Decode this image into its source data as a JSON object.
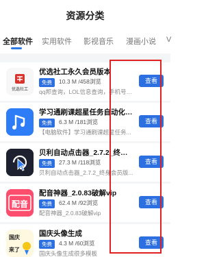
{
  "header": {
    "title": "资源分类"
  },
  "tabs": [
    {
      "label": "全部软件",
      "active": true
    },
    {
      "label": "实用软件",
      "active": false
    },
    {
      "label": "影视音乐",
      "active": false
    },
    {
      "label": "漫画小说",
      "active": false
    },
    {
      "label": "V",
      "active": false
    }
  ],
  "apps": [
    {
      "name": "优选社工永久会员版本",
      "badge": "免费",
      "stats": "10.3 M /458浏览",
      "desc": "qq邦查询，LOL信息查询，手机号反...",
      "icon": "youxuan-logo-icon",
      "icon_text": "优选社工",
      "button": "查看"
    },
    {
      "name": "学习通刷课超星任务自动化脚...",
      "badge": "免费",
      "stats": "6.3 M /181浏览",
      "desc": "【电脑软件】学习通刷课超星任务...",
      "icon": "music-note-icon",
      "button": "查看"
    },
    {
      "name": "贝利自动点击器_2.7.2_终身会...",
      "badge": "免费",
      "stats": "27.3 M /118浏览",
      "desc": "贝利自动点击器_2.7.2_终身会员版...",
      "icon": "pointer-click-icon",
      "button": "查看"
    },
    {
      "name": "配音神器_2.0.83破解vip",
      "badge": "免费",
      "stats": "62.4 M /92浏览",
      "desc": "配音神器_2.0.83破解vip",
      "icon": "dubbing-app-icon",
      "icon_text": "配音",
      "button": "查看"
    },
    {
      "name": "国庆头像生成",
      "badge": "免费",
      "stats": "4.3 M /60浏览",
      "desc": "国庆头像生成很多模板",
      "icon": "national-day-icon",
      "icon_text_top": "国庆",
      "icon_text_bottom": "来了",
      "button": "查看"
    }
  ],
  "colors": {
    "accent": "#2c6fe0",
    "highlight": "#e02020"
  }
}
